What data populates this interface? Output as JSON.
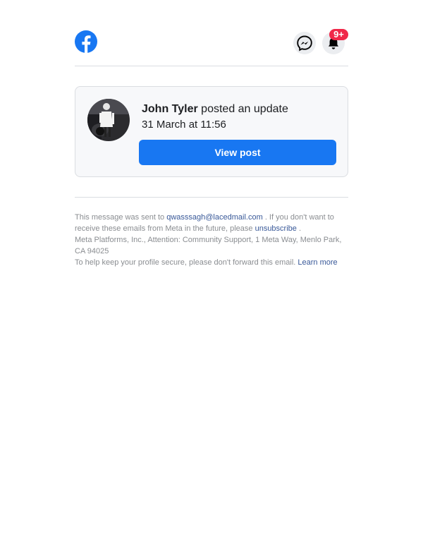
{
  "header": {
    "logo_icon": "facebook-logo-icon",
    "messenger_icon": "messenger-icon",
    "notifications_icon": "bell-icon",
    "notification_badge": "9+"
  },
  "card": {
    "avatar_alt": "profile photo",
    "name": "John Tyler",
    "action": "posted an update",
    "date": "31 March at 11:56",
    "button_label": "View post"
  },
  "footer": {
    "sent_to_prefix": "This message was sent to",
    "email": "qwasssagh@lacedmail.com",
    "unsubscribe_prefix": ". If you don't want to receive these emails from Meta in the future, please",
    "unsubscribe_link": "unsubscribe",
    "unsubscribe_suffix": ".",
    "address": "Meta Platforms, Inc., Attention: Community Support, 1 Meta Way, Menlo Park, CA 94025",
    "secure_text": "To help keep your profile secure, please don't forward this email.",
    "learn_more": "Learn more"
  },
  "colors": {
    "brand": "#1877f2",
    "badge": "#f02849",
    "link": "#385898"
  }
}
